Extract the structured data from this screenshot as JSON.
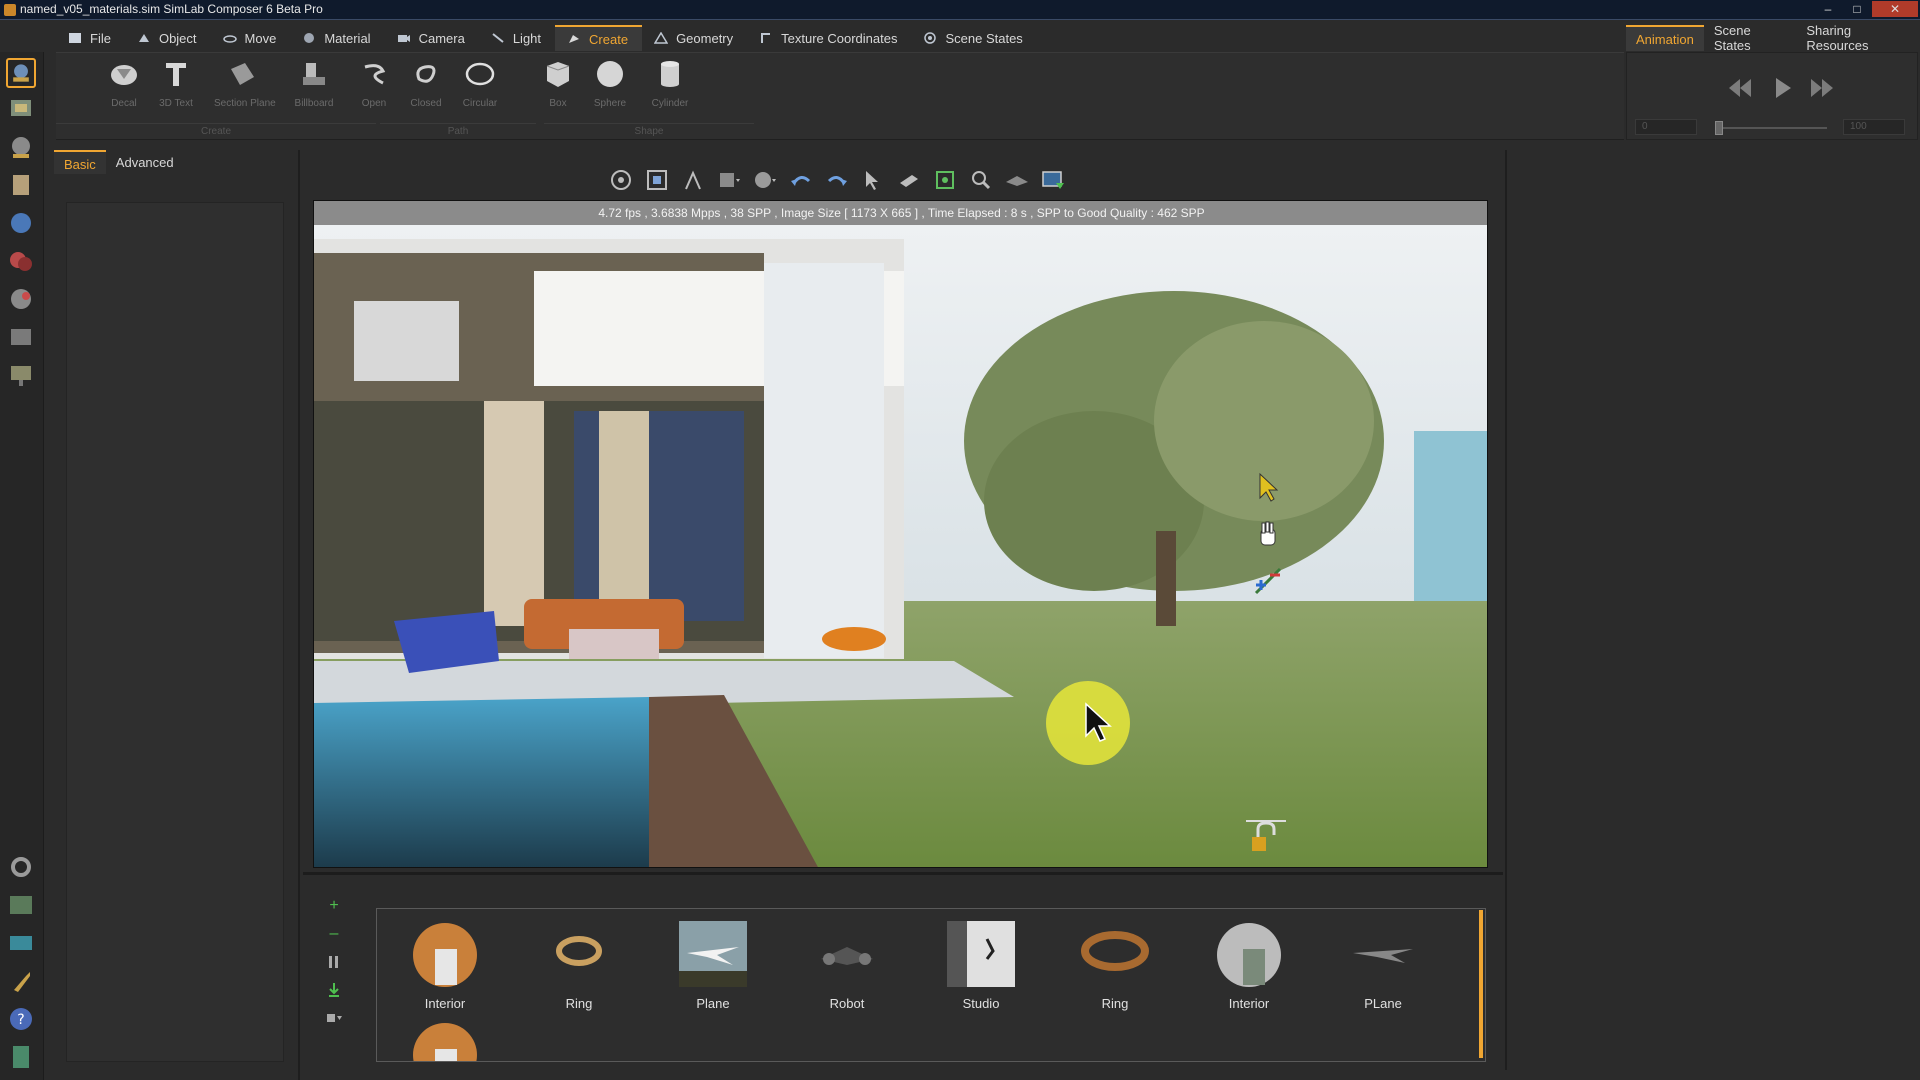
{
  "window": {
    "title": "named_v05_materials.sim SimLab Composer 6 Beta Pro",
    "min": "–",
    "max": "□",
    "close": "✕"
  },
  "menu": {
    "tabs": [
      {
        "label": "File",
        "icon": "file-icon"
      },
      {
        "label": "Object",
        "icon": "object-icon"
      },
      {
        "label": "Move",
        "icon": "move-icon"
      },
      {
        "label": "Material",
        "icon": "material-icon"
      },
      {
        "label": "Camera",
        "icon": "camera-icon"
      },
      {
        "label": "Light",
        "icon": "light-icon"
      },
      {
        "label": "Create",
        "icon": "create-icon",
        "active": true
      },
      {
        "label": "Geometry",
        "icon": "geometry-icon"
      },
      {
        "label": "Texture Coordinates",
        "icon": "texture-icon"
      },
      {
        "label": "Scene States",
        "icon": "scene-states-icon"
      }
    ],
    "right_tabs": [
      {
        "label": "Animation",
        "active": true
      },
      {
        "label": "Scene States"
      },
      {
        "label": "Sharing Resources"
      }
    ]
  },
  "ribbon": {
    "buttons": [
      {
        "label": "Decal",
        "icon": "decal-icon"
      },
      {
        "label": "3D Text",
        "icon": "text-3d-icon"
      },
      {
        "label": "Section Plane",
        "icon": "section-plane-icon"
      },
      {
        "label": "Billboard",
        "icon": "billboard-icon"
      },
      {
        "label": "Open",
        "icon": "open-curve-icon"
      },
      {
        "label": "Closed",
        "icon": "closed-curve-icon"
      },
      {
        "label": "Circular",
        "icon": "circular-curve-icon"
      },
      {
        "label": "Box",
        "icon": "box-icon"
      },
      {
        "label": "Sphere",
        "icon": "sphere-icon"
      },
      {
        "label": "Cylinder",
        "icon": "cylinder-icon"
      }
    ],
    "groups": [
      "Create",
      "Path",
      "Shape"
    ]
  },
  "animation": {
    "start_value": "0",
    "end_value": "100",
    "current_fraction": 0.0
  },
  "properties": {
    "tabs": [
      {
        "label": "Basic",
        "active": true
      },
      {
        "label": "Advanced"
      }
    ]
  },
  "viewport": {
    "status": "4.72 fps ,  3.6838 Mpps  ,  38 SPP     ,  Image Size [ 1173 X 665 ]  , Time Elapsed : 8 s  , SPP to Good Quality : 462 SPP",
    "scene": "render-preview"
  },
  "library": {
    "items": [
      {
        "name": "Interior",
        "thumb": "interior-thumb"
      },
      {
        "name": "Ring",
        "thumb": "ring-thumb"
      },
      {
        "name": "Plane",
        "thumb": "plane-thumb"
      },
      {
        "name": "Robot",
        "thumb": "robot-thumb"
      },
      {
        "name": "Studio",
        "thumb": "studio-thumb"
      },
      {
        "name": "Ring",
        "thumb": "ring-thumb"
      },
      {
        "name": "Interior",
        "thumb": "interior-thumb"
      },
      {
        "name": "PLane",
        "thumb": "plane-thumb"
      },
      {
        "name": "",
        "thumb": "interior-thumb"
      }
    ]
  },
  "colors": {
    "accent": "#f0a632",
    "background": "#2b2b2b",
    "status_bar": "#8b8b8b"
  }
}
